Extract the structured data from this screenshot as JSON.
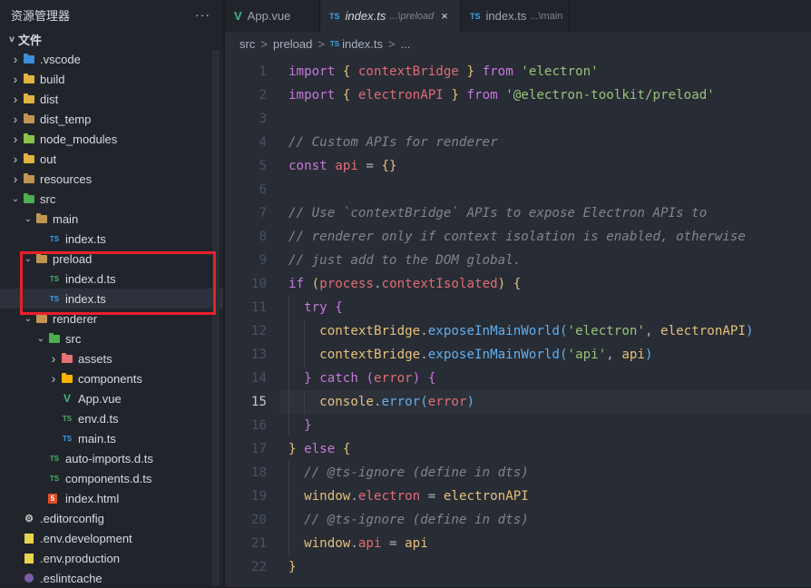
{
  "sidebar": {
    "title": "资源管理器",
    "more": "···",
    "section": "文件",
    "tree": [
      {
        "label": ".vscode",
        "depth": 0,
        "twist": ">",
        "icon": "folder-vscode-icon",
        "kind": "vscode"
      },
      {
        "label": "build",
        "depth": 0,
        "twist": ">",
        "icon": "folder-build-icon",
        "kind": "build"
      },
      {
        "label": "dist",
        "depth": 0,
        "twist": ">",
        "icon": "folder-dist-icon",
        "kind": "build"
      },
      {
        "label": "dist_temp",
        "depth": 0,
        "twist": ">",
        "icon": "folder-icon",
        "kind": "plain"
      },
      {
        "label": "node_modules",
        "depth": 0,
        "twist": ">",
        "icon": "folder-node-icon",
        "kind": "node"
      },
      {
        "label": "out",
        "depth": 0,
        "twist": ">",
        "icon": "folder-out-icon",
        "kind": "build"
      },
      {
        "label": "resources",
        "depth": 0,
        "twist": ">",
        "icon": "folder-icon",
        "kind": "plain"
      },
      {
        "label": "src",
        "depth": 0,
        "twist": "v",
        "icon": "folder-src-icon",
        "kind": "src"
      },
      {
        "label": "main",
        "depth": 1,
        "twist": "v",
        "icon": "folder-icon",
        "kind": "plain"
      },
      {
        "label": "index.ts",
        "depth": 2,
        "twist": "",
        "icon": "typescript-icon",
        "kind": "ts"
      },
      {
        "label": "preload",
        "depth": 1,
        "twist": "v",
        "icon": "folder-icon",
        "kind": "plain"
      },
      {
        "label": "index.d.ts",
        "depth": 2,
        "twist": "",
        "icon": "typescript-def-icon",
        "kind": "dts"
      },
      {
        "label": "index.ts",
        "depth": 2,
        "twist": "",
        "icon": "typescript-icon",
        "kind": "ts",
        "selected": true
      },
      {
        "label": "renderer",
        "depth": 1,
        "twist": "v",
        "icon": "folder-icon",
        "kind": "plain"
      },
      {
        "label": "src",
        "depth": 2,
        "twist": "v",
        "icon": "folder-src-icon",
        "kind": "src"
      },
      {
        "label": "assets",
        "depth": 3,
        "twist": ">",
        "icon": "folder-assets-icon",
        "kind": "assets"
      },
      {
        "label": "components",
        "depth": 3,
        "twist": ">",
        "icon": "folder-components-icon",
        "kind": "comp"
      },
      {
        "label": "App.vue",
        "depth": 3,
        "twist": "",
        "icon": "vue-icon",
        "kind": "vue"
      },
      {
        "label": "env.d.ts",
        "depth": 3,
        "twist": "",
        "icon": "typescript-def-icon",
        "kind": "dts"
      },
      {
        "label": "main.ts",
        "depth": 3,
        "twist": "",
        "icon": "typescript-icon",
        "kind": "ts"
      },
      {
        "label": "auto-imports.d.ts",
        "depth": 2,
        "twist": "",
        "icon": "typescript-def-icon",
        "kind": "dts"
      },
      {
        "label": "components.d.ts",
        "depth": 2,
        "twist": "",
        "icon": "typescript-def-icon",
        "kind": "dts"
      },
      {
        "label": "index.html",
        "depth": 2,
        "twist": "",
        "icon": "html5-icon",
        "kind": "html"
      },
      {
        "label": ".editorconfig",
        "depth": 0,
        "twist": "",
        "icon": "editorconfig-icon",
        "kind": "gear"
      },
      {
        "label": ".env.development",
        "depth": 0,
        "twist": "",
        "icon": "env-file-icon",
        "kind": "yel"
      },
      {
        "label": ".env.production",
        "depth": 0,
        "twist": "",
        "icon": "env-file-icon",
        "kind": "yel"
      },
      {
        "label": ".eslintcache",
        "depth": 0,
        "twist": "",
        "icon": "eslint-icon",
        "kind": "circle"
      }
    ]
  },
  "tabs": [
    {
      "label": "App.vue",
      "icon": "vue-icon",
      "glyph": "V",
      "hint": "",
      "active": false
    },
    {
      "label": "index.ts",
      "icon": "typescript-icon",
      "glyph": "TS",
      "hint": "...\\preload",
      "active": true,
      "close": "×"
    },
    {
      "label": "index.ts",
      "icon": "typescript-icon",
      "glyph": "TS",
      "hint": "...\\main",
      "active": false
    }
  ],
  "breadcrumb": [
    "src",
    ">",
    "preload",
    ">",
    "TS",
    "index.ts",
    ">",
    "..."
  ],
  "editor": {
    "current_line": 15,
    "lines": [
      [
        [
          "k",
          "import"
        ],
        [
          "p",
          " "
        ],
        [
          "b1",
          "{"
        ],
        [
          "p",
          " "
        ],
        [
          "v",
          "contextBridge"
        ],
        [
          "p",
          " "
        ],
        [
          "b1",
          "}"
        ],
        [
          "p",
          " "
        ],
        [
          "k",
          "from"
        ],
        [
          "p",
          " "
        ],
        [
          "s",
          "'electron'"
        ]
      ],
      [
        [
          "k",
          "import"
        ],
        [
          "p",
          " "
        ],
        [
          "b1",
          "{"
        ],
        [
          "p",
          " "
        ],
        [
          "v",
          "electronAPI"
        ],
        [
          "p",
          " "
        ],
        [
          "b1",
          "}"
        ],
        [
          "p",
          " "
        ],
        [
          "k",
          "from"
        ],
        [
          "p",
          " "
        ],
        [
          "s",
          "'@electron-toolkit/preload'"
        ]
      ],
      [],
      [
        [
          "c",
          "// Custom APIs for renderer"
        ]
      ],
      [
        [
          "k",
          "const"
        ],
        [
          "p",
          " "
        ],
        [
          "v",
          "api"
        ],
        [
          "p",
          " = "
        ],
        [
          "b1",
          "{}"
        ]
      ],
      [],
      [
        [
          "c",
          "// Use `contextBridge` APIs to expose Electron APIs to"
        ]
      ],
      [
        [
          "c",
          "// renderer only if context isolation is enabled, otherwise"
        ]
      ],
      [
        [
          "c",
          "// just add to the DOM global."
        ]
      ],
      [
        [
          "k",
          "if"
        ],
        [
          "p",
          " "
        ],
        [
          "b1",
          "("
        ],
        [
          "v",
          "process"
        ],
        [
          "p",
          "."
        ],
        [
          "v",
          "contextIsolated"
        ],
        [
          "b1",
          ")"
        ],
        [
          "p",
          " "
        ],
        [
          "b1",
          "{"
        ]
      ],
      [
        [
          "p",
          "  "
        ],
        [
          "k",
          "try"
        ],
        [
          "p",
          " "
        ],
        [
          "b2",
          "{"
        ]
      ],
      [
        [
          "p",
          "    "
        ],
        [
          "y",
          "contextBridge"
        ],
        [
          "p",
          "."
        ],
        [
          "f",
          "exposeInMainWorld"
        ],
        [
          "b3",
          "("
        ],
        [
          "s",
          "'electron'"
        ],
        [
          "p",
          ", "
        ],
        [
          "y",
          "electronAPI"
        ],
        [
          "b3",
          ")"
        ]
      ],
      [
        [
          "p",
          "    "
        ],
        [
          "y",
          "contextBridge"
        ],
        [
          "p",
          "."
        ],
        [
          "f",
          "exposeInMainWorld"
        ],
        [
          "b3",
          "("
        ],
        [
          "s",
          "'api'"
        ],
        [
          "p",
          ", "
        ],
        [
          "y",
          "api"
        ],
        [
          "b3",
          ")"
        ]
      ],
      [
        [
          "p",
          "  "
        ],
        [
          "b2",
          "}"
        ],
        [
          "p",
          " "
        ],
        [
          "k",
          "catch"
        ],
        [
          "p",
          " "
        ],
        [
          "b2",
          "("
        ],
        [
          "v",
          "error"
        ],
        [
          "b2",
          ")"
        ],
        [
          "p",
          " "
        ],
        [
          "b2",
          "{"
        ]
      ],
      [
        [
          "p",
          "    "
        ],
        [
          "y",
          "console"
        ],
        [
          "p",
          "."
        ],
        [
          "f",
          "error"
        ],
        [
          "b3",
          "("
        ],
        [
          "v",
          "error"
        ],
        [
          "b3",
          ")"
        ]
      ],
      [
        [
          "p",
          "  "
        ],
        [
          "b2",
          "}"
        ]
      ],
      [
        [
          "b1",
          "}"
        ],
        [
          "p",
          " "
        ],
        [
          "k",
          "else"
        ],
        [
          "p",
          " "
        ],
        [
          "b1",
          "{"
        ]
      ],
      [
        [
          "p",
          "  "
        ],
        [
          "c",
          "// @ts-ignore (define in dts)"
        ]
      ],
      [
        [
          "p",
          "  "
        ],
        [
          "y",
          "window"
        ],
        [
          "p",
          "."
        ],
        [
          "v",
          "electron"
        ],
        [
          "p",
          " = "
        ],
        [
          "y",
          "electronAPI"
        ]
      ],
      [
        [
          "p",
          "  "
        ],
        [
          "c",
          "// @ts-ignore (define in dts)"
        ]
      ],
      [
        [
          "p",
          "  "
        ],
        [
          "y",
          "window"
        ],
        [
          "p",
          "."
        ],
        [
          "v",
          "api"
        ],
        [
          "p",
          " = "
        ],
        [
          "y",
          "api"
        ]
      ],
      [
        [
          "b1",
          "}"
        ]
      ]
    ]
  }
}
